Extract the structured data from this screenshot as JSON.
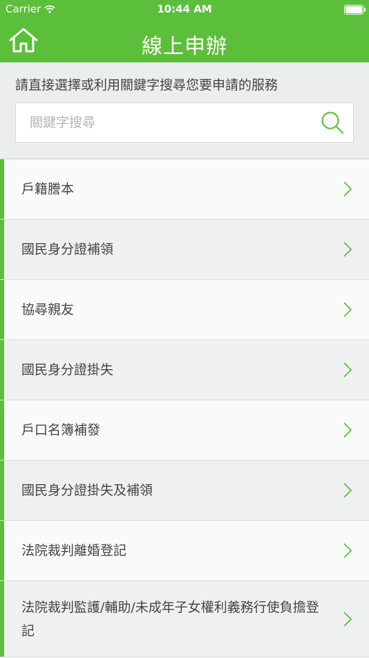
{
  "status_bar": {
    "carrier": "Carrier",
    "time": "10:44 AM"
  },
  "header": {
    "title": "線上申辦",
    "home_icon": "home-icon"
  },
  "search": {
    "instruction": "請直接選擇或利用關鍵字搜尋您要申請的服務",
    "placeholder": "關鍵字搜尋",
    "value": ""
  },
  "services": [
    {
      "label": "戶籍謄本"
    },
    {
      "label": "國民身分證補領"
    },
    {
      "label": "協尋親友"
    },
    {
      "label": "國民身分證掛失"
    },
    {
      "label": "戶口名簿補發"
    },
    {
      "label": "國民身分證掛失及補領"
    },
    {
      "label": "法院裁判離婚登記"
    },
    {
      "label": "法院裁判監護/輔助/未成年子女權利義務行使負擔登記"
    }
  ],
  "colors": {
    "accent": "#5cbf3b",
    "text": "#444444"
  }
}
